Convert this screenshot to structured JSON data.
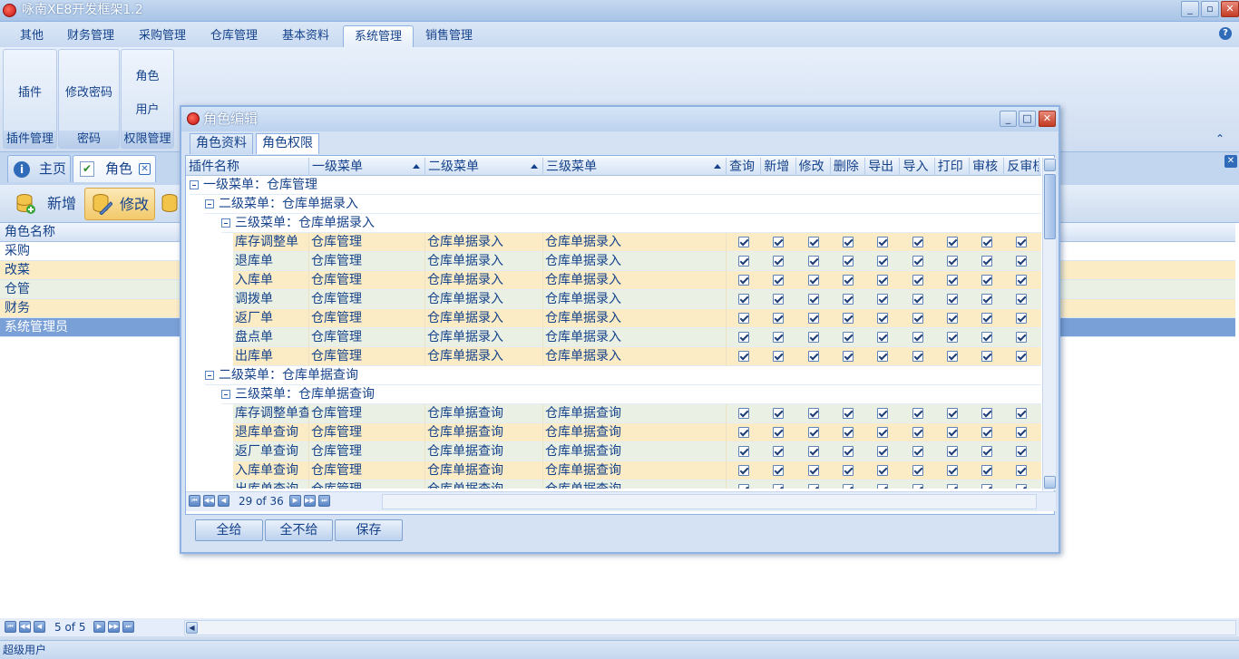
{
  "app": {
    "title": "咏南XE8开发框架1.2",
    "min": "_",
    "restore": "▫",
    "close": "✕"
  },
  "menu": [
    "其他",
    "财务管理",
    "采购管理",
    "仓库管理",
    "基本资料",
    "系统管理",
    "销售管理"
  ],
  "ribbon": {
    "groups": [
      {
        "label": "插件管理",
        "buttons": [
          "插件"
        ]
      },
      {
        "label": "密码",
        "buttons": [
          "修改密码"
        ]
      },
      {
        "label": "权限管理",
        "buttons": [
          "角色",
          "用户"
        ]
      }
    ],
    "collapse": "⌃"
  },
  "doctabs": [
    {
      "label": "主页"
    },
    {
      "label": "角色"
    }
  ],
  "toolbar": {
    "add": "新增",
    "edit": "修改"
  },
  "main_grid": {
    "header": "角色名称",
    "rows": [
      "采购",
      "改菜",
      "仓管",
      "财务",
      "系统管理员"
    ],
    "selected": 4,
    "pager": "5 of 5"
  },
  "status": "超级用户",
  "dialog": {
    "title": "角色编辑",
    "tabs": [
      "角色资料",
      "角色权限"
    ],
    "columns": [
      "插件名称",
      "一级菜单",
      "二级菜单",
      "三级菜单",
      "查询",
      "新增",
      "修改",
      "删除",
      "导出",
      "导入",
      "打印",
      "审核",
      "反审核"
    ],
    "tree": [
      {
        "type": "g1",
        "text": "一级菜单：仓库管理"
      },
      {
        "type": "g2",
        "text": "二级菜单：仓库单据录入"
      },
      {
        "type": "g3",
        "text": "三级菜单：仓库单据录入"
      },
      {
        "type": "row",
        "cells": [
          "库存调整单",
          "仓库管理",
          "仓库单据录入",
          "仓库单据录入"
        ]
      },
      {
        "type": "row",
        "cells": [
          "退库单",
          "仓库管理",
          "仓库单据录入",
          "仓库单据录入"
        ]
      },
      {
        "type": "row",
        "cells": [
          "入库单",
          "仓库管理",
          "仓库单据录入",
          "仓库单据录入"
        ]
      },
      {
        "type": "row",
        "cells": [
          "调拨单",
          "仓库管理",
          "仓库单据录入",
          "仓库单据录入"
        ]
      },
      {
        "type": "row",
        "cells": [
          "返厂单",
          "仓库管理",
          "仓库单据录入",
          "仓库单据录入"
        ]
      },
      {
        "type": "row",
        "cells": [
          "盘点单",
          "仓库管理",
          "仓库单据录入",
          "仓库单据录入"
        ]
      },
      {
        "type": "row",
        "cells": [
          "出库单",
          "仓库管理",
          "仓库单据录入",
          "仓库单据录入"
        ]
      },
      {
        "type": "g2",
        "text": "二级菜单：仓库单据查询"
      },
      {
        "type": "g3",
        "text": "三级菜单：仓库单据查询"
      },
      {
        "type": "row",
        "cells": [
          "库存调整单查询",
          "仓库管理",
          "仓库单据查询",
          "仓库单据查询"
        ]
      },
      {
        "type": "row",
        "cells": [
          "退库单查询",
          "仓库管理",
          "仓库单据查询",
          "仓库单据查询"
        ]
      },
      {
        "type": "row",
        "cells": [
          "返厂单查询",
          "仓库管理",
          "仓库单据查询",
          "仓库单据查询"
        ]
      },
      {
        "type": "row",
        "cells": [
          "入库单查询",
          "仓库管理",
          "仓库单据查询",
          "仓库单据查询"
        ]
      },
      {
        "type": "row",
        "cells": [
          "出库单查询",
          "仓库管理",
          "仓库单据查询",
          "仓库单据查询"
        ]
      }
    ],
    "pager": "29 of 36",
    "buttons": {
      "grant_all": "全给",
      "revoke_all": "全不给",
      "save": "保存"
    }
  }
}
